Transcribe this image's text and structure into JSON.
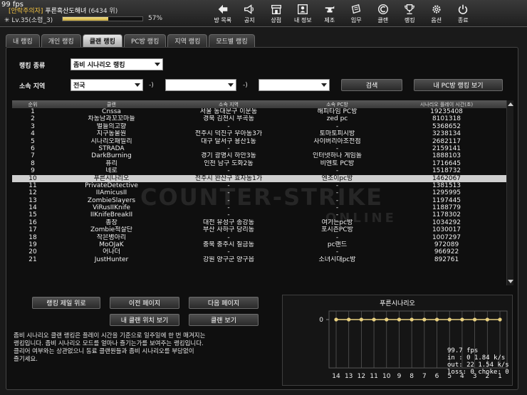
{
  "fps": "99 fps",
  "user": {
    "guild_tag": "[안락주의자]",
    "nickname": "푸른흑산도해녀",
    "rank": "(6434 위)",
    "level_line": "Lv.35(소령_3)",
    "xp_fraction": 0.57,
    "xp_percent": "57%"
  },
  "nav": [
    {
      "label": "방 목록",
      "icon": "back-arrow-icon"
    },
    {
      "label": "공지",
      "icon": "megaphone-icon"
    },
    {
      "label": "상점",
      "icon": "shop-icon"
    },
    {
      "label": "내 정보",
      "icon": "id-card-icon"
    },
    {
      "label": "제조",
      "icon": "anvil-icon"
    },
    {
      "label": "임무",
      "icon": "mission-icon"
    },
    {
      "label": "클랜",
      "icon": "clan-icon"
    },
    {
      "label": "랭킹",
      "icon": "trophy-icon"
    },
    {
      "label": "옵션",
      "icon": "gear-icon"
    },
    {
      "label": "종료",
      "icon": "power-icon"
    }
  ],
  "tabs": [
    "내 랭킹",
    "개인 랭킹",
    "클랜 랭킹",
    "PC방 랭킹",
    "지역 랭킹",
    "모드별 랭킹"
  ],
  "active_tab": 2,
  "filters": {
    "ranking_type_label": "랭킹 종류",
    "ranking_type_value": "좀비 시나리오 랭킹",
    "region_label": "소속 지역",
    "region1_value": "전국",
    "region2_value": "",
    "region3_value": "",
    "separator": "-)",
    "search_button": "검색",
    "my_pc_button": "내 PC방 랭킹 보기"
  },
  "table": {
    "headers": [
      "순위",
      "클랜",
      "소속 지역",
      "소속 PC방",
      "시나리오 플레이 시간(초)"
    ],
    "selected_index": 9,
    "rows": [
      [
        "1",
        "Cnssa",
        "서울 동대문구 이문동",
        "해피타임 PC방",
        "19235408"
      ],
      [
        "2",
        "차농남과꼬꼬마들",
        "경북 김천시 부곡동",
        "zed pc",
        "8101318"
      ],
      [
        "3",
        "벌들의고향",
        "-",
        "-",
        "5368652"
      ],
      [
        "4",
        "지구동물원",
        "전주시 덕진구 우아동3가",
        "토마토피시방",
        "3238134"
      ],
      [
        "5",
        "시나리오패밀리",
        "대구 달서구 용산1동",
        "사이버리아조전점",
        "2682117"
      ],
      [
        "6",
        "STRADA",
        "-",
        "-",
        "2159141"
      ],
      [
        "7",
        "DarkBurning",
        "경기 광명시 하안3동",
        "인터넷하나 게임돌",
        "1888103"
      ],
      [
        "8",
        "퓨리",
        "인천 남구 도화2동",
        "비엔토 PC방",
        "1716645"
      ],
      [
        "9",
        "네로",
        "-",
        "-",
        "1518732"
      ],
      [
        "10",
        "푸른시나리오",
        "전주시 완산구 효자동1가",
        "엔조이pc방",
        "1462067"
      ],
      [
        "11",
        "PrivateDetective",
        "-",
        "-",
        "1381513"
      ],
      [
        "12",
        "IIAmicusII",
        "-",
        "-",
        "1295995"
      ],
      [
        "13",
        "ZombieSlayers",
        "-",
        "-",
        "1197445"
      ],
      [
        "14",
        "ViRusIIKnife",
        "-",
        "-",
        "1188779"
      ],
      [
        "15",
        "IIKnifeBreakII",
        "-",
        "-",
        "1178302"
      ],
      [
        "16",
        "총장",
        "대전 유성구 송강동",
        "여기는pc방",
        "1034292"
      ],
      [
        "17",
        "Zombie척살단",
        "부산 사하구 당리동",
        "포시즌PC방",
        "1030017"
      ],
      [
        "18",
        "작은병아리",
        "-",
        "-",
        "1007297"
      ],
      [
        "19",
        "MoOJaK",
        "충북 충주시 칠금동",
        "pc랜드",
        "972089"
      ],
      [
        "20",
        "어나더",
        "-",
        "-",
        "966922"
      ],
      [
        "21",
        "JustHunter",
        "강원 양구군 양구읍",
        "소녀시대pc방",
        "892761"
      ]
    ],
    "watermark": "COUNTER-STRIKE ONLINE"
  },
  "buttons": {
    "top": "랭킹 제일 위로",
    "prev": "이전 페이지",
    "next": "다음 페이지",
    "my_clan": "내 클랜 위치 보기",
    "clan_info": "클랜 보기"
  },
  "description": [
    "좀비 시나리오 클랜 랭킹은 플레이 시간을 기준으로 일주일에 한 번 매겨지는",
    "랭킹입니다. 좀비 시나리오 모드를 얼마나 즐기는가를 보여주는 랭킹입니다.",
    "클리어 여부와는 상관없으니 동료 클랜원들과 좀비 시나리오를 부담없이",
    "즐기세요."
  ],
  "chart_data": {
    "type": "line",
    "title": "푸른시나리오",
    "x": [
      14,
      13,
      12,
      11,
      10,
      9,
      8,
      7,
      6,
      5,
      4,
      3,
      2,
      1
    ],
    "y": [
      0,
      0,
      0,
      0,
      0,
      0,
      0,
      0,
      0,
      0,
      0,
      0,
      0,
      0
    ],
    "y_tick": "0",
    "color": "#e8d080"
  },
  "netstats": [
    "99.7 fps",
    "in : 0 1.84 k/s",
    "out: 22 1.54 k/s",
    "loss: 0 choke: 0"
  ]
}
